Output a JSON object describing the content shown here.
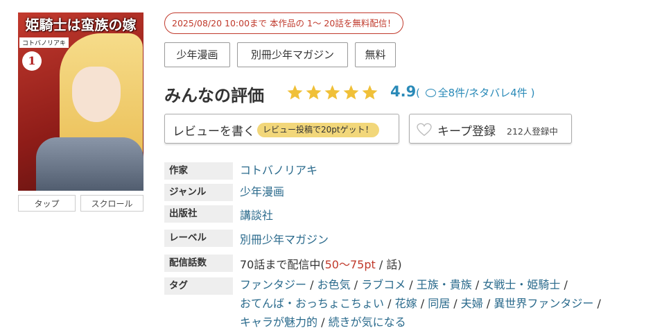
{
  "cover": {
    "title": "姫騎士は蛮族の嫁",
    "author": "コトバノリアキ",
    "volume": "1"
  },
  "view_modes": [
    "タップ",
    "スクロール"
  ],
  "free_notice": "2025/08/20 10:00まで 本作品の 1～ 20話を無料配信！",
  "tags_top": [
    "少年漫画",
    "別冊少年マガジン",
    "無料"
  ],
  "rating": {
    "heading": "みんなの評価",
    "stars": 5,
    "score": "4.9",
    "counts_open": "(",
    "counts": "全8件/ネタバレ4件",
    "counts_close": ")"
  },
  "review": {
    "label": "レビューを書く",
    "badge": "レビュー投稿で20ptゲット！"
  },
  "keep": {
    "label": "キープ登録",
    "count": "212人登録中"
  },
  "details": {
    "author": {
      "label": "作家",
      "value": "コトバノリアキ"
    },
    "genre": {
      "label": "ジャンル",
      "value": "少年漫画"
    },
    "publisher": {
      "label": "出版社",
      "value": "講談社"
    },
    "label_row": {
      "label": "レーベル",
      "value": "別冊少年マガジン"
    },
    "episodes": {
      "label": "配信話数",
      "prefix": "70話まで配信中(",
      "pt": "50～75pt",
      "suffix": " / 話)"
    },
    "tags": {
      "label": "タグ",
      "items": [
        "ファンタジー",
        "お色気",
        "ラブコメ",
        "王族・貴族",
        "女戦士・姫騎士",
        "おてんば・おっちょこちょい",
        "花嫁",
        "同居",
        "夫婦",
        "異世界ファンタジー",
        "キャラが魅力的",
        "続きが気になる"
      ]
    }
  },
  "colors": {
    "link": "#2a6a8c",
    "accent_blue": "#2a8ab8",
    "star": "#f0c038",
    "notice_red": "#c0392b",
    "badge_yellow": "#f2d77a"
  }
}
